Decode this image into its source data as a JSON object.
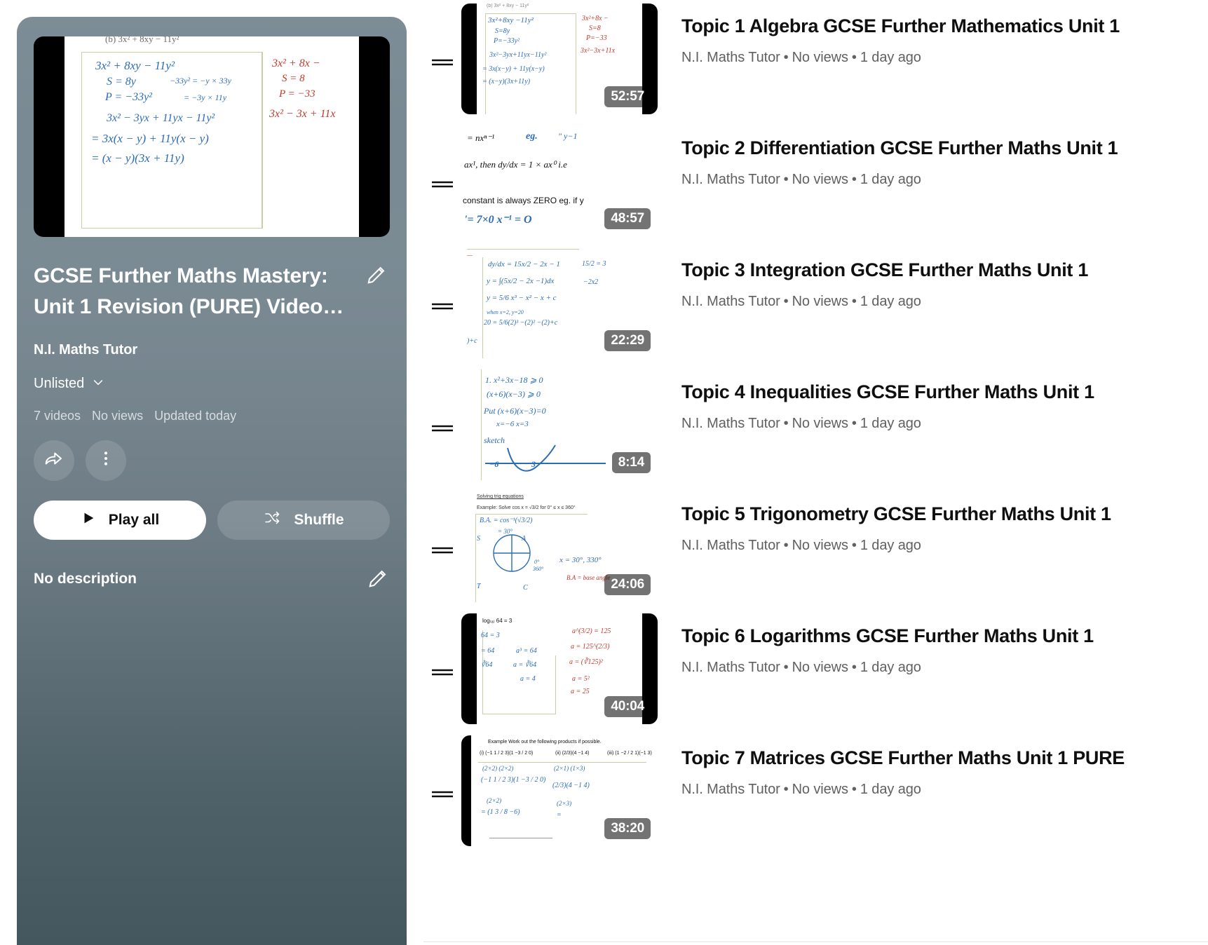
{
  "playlist": {
    "title": "GCSE Further Maths Mastery: Unit 1 Revision (PURE) Video…",
    "channel": "N.I. Maths Tutor",
    "visibility": "Unlisted",
    "visibility_chevron": "chevron-down-icon",
    "stats": {
      "video_count": "7 videos",
      "views": "No views",
      "updated": "Updated today"
    },
    "edit_title_icon": "pencil-icon",
    "share_icon": "share-icon",
    "more_icon": "more-vertical-icon",
    "play_all_label": "Play all",
    "play_icon": "play-icon",
    "shuffle_label": "Shuffle",
    "shuffle_icon": "shuffle-icon",
    "description": "No description",
    "edit_description_icon": "pencil-icon",
    "hero_thumbnail": {
      "header": "(b) 3x² + 8xy − 11y²",
      "lines": [
        "3x² + 8xy − 11y²",
        "S = 8y",
        "P = −33y²",
        "−33y² = −y × 33y",
        "= −3y × 11y",
        "3x² − 3yx + 11yx − 11y²",
        "= 3x(x − y) + 11y(x − y)",
        "= (x − y)(3x + 11y)"
      ],
      "side_notes": [
        "3x² + 8x −",
        "S = 8",
        "P = −33",
        "3x² − 3x + 11x"
      ]
    }
  },
  "colors": {
    "panel_top": "#7d8d96",
    "panel_bottom": "#44565e",
    "title_text": "#0f0f0f",
    "meta_text": "#606060",
    "duration_badge": "#000000"
  },
  "videos": [
    {
      "index": 1,
      "drag_icon": "drag-handle-icon",
      "title": "Topic 1 Algebra GCSE Further Mathematics Unit 1",
      "channel": "N.I. Maths Tutor",
      "views": "No views",
      "age": "1 day ago",
      "duration": "52:57",
      "thumb_kind": "algebra",
      "thumb_text": [
        "3x²+8xy −11y²",
        "S=8y",
        "P=−33y²",
        "3x²−3yx+11yx−11y²",
        "= 3x(x−y) + 11y(x−y)",
        "= (x−y)(3x+11y)"
      ],
      "thumb_text_red": [
        "3x²+8x −",
        "S=8",
        "P=−33",
        "3x²−3x+11x"
      ]
    },
    {
      "index": 2,
      "drag_icon": "drag-handle-icon",
      "title": "Topic 2 Differentiation GCSE Further Maths Unit 1",
      "channel": "N.I. Maths Tutor",
      "views": "No views",
      "age": "1 day ago",
      "duration": "48:57",
      "thumb_kind": "differentiation",
      "thumb_text": [
        "= nxⁿ⁻¹",
        "eg.",
        "\" y−1",
        "ax¹,  then dy/dx = 1 × ax⁰  i.e",
        "constant is always ZERO eg. if y",
        "'= 7×0 x⁻¹ = O"
      ]
    },
    {
      "index": 3,
      "drag_icon": "drag-handle-icon",
      "title": "Topic 3 Integration GCSE Further Maths Unit 1",
      "channel": "N.I. Maths Tutor",
      "views": "No views",
      "age": "1 day ago",
      "duration": "22:29",
      "thumb_kind": "integration",
      "thumb_text": [
        "dy/dx = 15x/2 − 2x − 1",
        "y = ∫(5x/2 − 2x −1)dx",
        "y = 5/6 x³ − x² − x + c",
        "when x=2, y=20",
        "20 = 5/6(2)³ −(2)² −(2)+c",
        "15/2 = 3",
        "−2x2",
        ")+c"
      ]
    },
    {
      "index": 4,
      "drag_icon": "drag-handle-icon",
      "title": "Topic 4 Inequalities GCSE Further Maths Unit 1",
      "channel": "N.I. Maths Tutor",
      "views": "No views",
      "age": "1 day ago",
      "duration": "8:14",
      "thumb_kind": "inequalities",
      "thumb_text": [
        "1. x²+3x−18 ⩾ 0",
        "(x+6)(x−3) ⩾ 0",
        "Put (x+6)(x−3)=0",
        "x=−6   x=3",
        "sketch",
        "−6",
        "3"
      ]
    },
    {
      "index": 5,
      "drag_icon": "drag-handle-icon",
      "title": "Topic 5 Trigonometry GCSE Further Maths Unit 1",
      "channel": "N.I. Maths Tutor",
      "views": "No views",
      "age": "1 day ago",
      "duration": "24:06",
      "thumb_kind": "trigonometry",
      "thumb_heading": "Solving trig equations",
      "thumb_example": "Example:   Solve cos x = √3/2  for 0° ≤ x ≤ 360°",
      "thumb_text": [
        "B.A. = cos⁻¹(√3/2)",
        "= 30°",
        "S",
        "A",
        "T",
        "C",
        "0°",
        "360°",
        "x = 30°, 330°",
        "B.A = base angle"
      ]
    },
    {
      "index": 6,
      "drag_icon": "drag-handle-icon",
      "title": "Topic 6 Logarithms GCSE Further Maths Unit 1",
      "channel": "N.I. Maths Tutor",
      "views": "No views",
      "age": "1 day ago",
      "duration": "40:04",
      "thumb_kind": "logarithms",
      "thumb_text": [
        "log₍ₐ₎ 64 = 3",
        "64 = 3",
        "= 64",
        "∛64",
        "a³ = 64",
        "a = ∛64",
        "a = 4"
      ],
      "thumb_text_red": [
        "a^(3/2) = 125",
        "a = 125^(2/3)",
        "a = (∛125)²",
        "a = 5²",
        "a = 25"
      ]
    },
    {
      "index": 7,
      "drag_icon": "drag-handle-icon",
      "title": "Topic 7 Matrices GCSE Further Maths Unit 1 PURE",
      "channel": "N.I. Maths Tutor",
      "views": "No views",
      "age": "1 day ago",
      "duration": "38:20",
      "thumb_kind": "matrices",
      "thumb_heading": "Example   Work out the following products if possible.",
      "thumb_text": [
        "(i) (−1 1 / 2 3)(1 −3 / 2 0)",
        "(ii) (2/3)(4  −1  4)",
        "(iii) (1 −2 / 2 1)(−1  3)",
        "(2×2)  (2×2)",
        "(2×1)  (1×3)",
        "(−1 1 / 2 3)(1 −3 / 2 0)",
        "(2×2)",
        "= (1  3 / 8 −6)",
        "(2/3)(4 −1 4)",
        "(2×3)",
        "="
      ]
    }
  ]
}
